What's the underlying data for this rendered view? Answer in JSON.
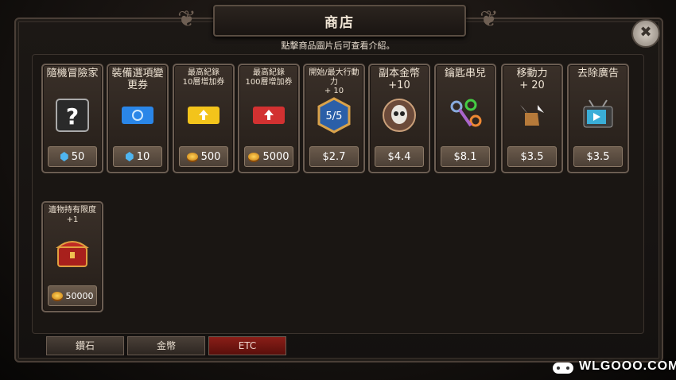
{
  "header": {
    "title": "商店",
    "subtitle": "點擊商品圖片后可查看介紹。"
  },
  "close": {
    "label": "✖"
  },
  "items": [
    {
      "name": "隨機冒險家",
      "icon": "question-card-icon",
      "currency": "gem",
      "price": "50"
    },
    {
      "name": "裝備選項變更券",
      "icon": "blue-ticket-icon",
      "currency": "gem",
      "price": "10"
    },
    {
      "name": "最高紀錄\n10層增加券",
      "icon": "yellow-ticket-icon",
      "currency": "coin",
      "price": "500"
    },
    {
      "name": "最高紀錄\n100層增加券",
      "icon": "red-ticket-icon",
      "currency": "coin",
      "price": "5000"
    },
    {
      "name": "開始/最大行動力\n+ 10",
      "icon": "hexagon-badge-icon",
      "icon_text": "5/5",
      "currency": "none",
      "price": "$2.7"
    },
    {
      "name": "副本金幣\n+10",
      "icon": "skull-coin-icon",
      "currency": "none",
      "price": "$4.4"
    },
    {
      "name": "鑰匙串兒",
      "icon": "keys-icon",
      "currency": "none",
      "price": "$8.1"
    },
    {
      "name": "移動力\n+ 20",
      "icon": "winged-boot-icon",
      "currency": "none",
      "price": "$3.5"
    },
    {
      "name": "去除廣告",
      "icon": "tv-icon",
      "currency": "none",
      "price": "$3.5"
    },
    {
      "name": "遺物持有限度\n+1",
      "icon": "treasure-chest-icon",
      "currency": "coin",
      "price": "50000"
    }
  ],
  "tabs": [
    {
      "label": "鑽石",
      "active": false
    },
    {
      "label": "金幣",
      "active": false
    },
    {
      "label": "ETC",
      "active": true
    }
  ],
  "watermark": "WLGOOO.COM"
}
